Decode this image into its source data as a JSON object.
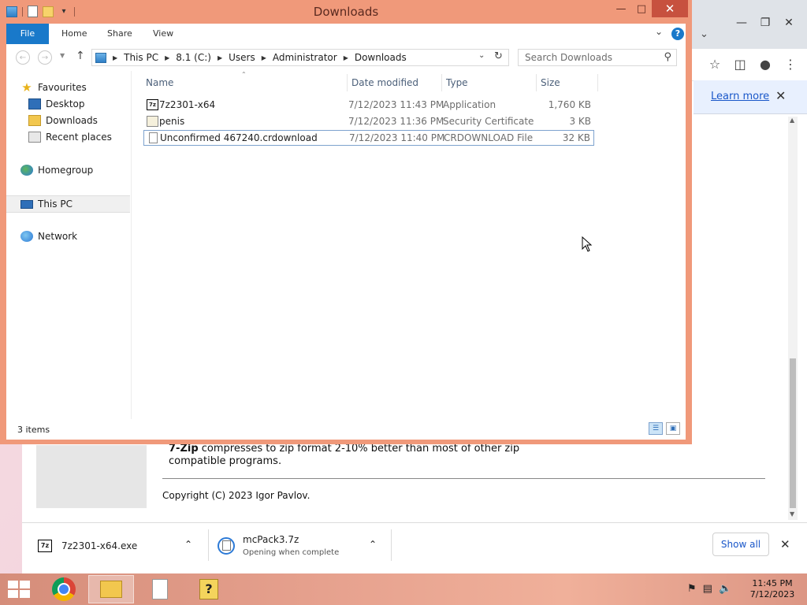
{
  "explorer": {
    "title": "Downloads",
    "ribbon_tabs": [
      "File",
      "Home",
      "Share",
      "View"
    ],
    "help": "?",
    "address": [
      "This PC",
      "8.1 (C:)",
      "Users",
      "Administrator",
      "Downloads"
    ],
    "search_placeholder": "Search Downloads",
    "nav": {
      "favourites": "Favourites",
      "desktop": "Desktop",
      "downloads": "Downloads",
      "recent": "Recent places",
      "homegroup": "Homegroup",
      "thispc": "This PC",
      "network": "Network"
    },
    "columns": {
      "name": "Name",
      "date": "Date modified",
      "type": "Type",
      "size": "Size"
    },
    "files": [
      {
        "name": "7z2301-x64",
        "date": "7/12/2023 11:43 PM",
        "type": "Application",
        "size": "1,760 KB",
        "icon": "7z-app-icon"
      },
      {
        "name": "penis",
        "date": "7/12/2023 11:36 PM",
        "type": "Security Certificate",
        "size": "3 KB",
        "icon": "certificate-icon"
      },
      {
        "name": "Unconfirmed 467240.crdownload",
        "date": "7/12/2023 11:40 PM",
        "type": "CRDOWNLOAD File",
        "size": "32 KB",
        "icon": "file-icon"
      }
    ],
    "status": "3 items",
    "accent": "#f0997a"
  },
  "browser": {
    "learn_more": "Learn more",
    "page_text_bold": "7-Zip",
    "page_text": " compresses to zip format 2-10% better than most of other zip compatible programs.",
    "copyright": "Copyright (C) 2023 Igor Pavlov.",
    "downloads": [
      {
        "name": "7z2301-x64.exe",
        "sub": ""
      },
      {
        "name": "mcPack3.7z",
        "sub": "Opening when complete"
      }
    ],
    "show_all": "Show all"
  },
  "taskbar": {
    "time": "11:45 PM",
    "date": "7/12/2023"
  }
}
